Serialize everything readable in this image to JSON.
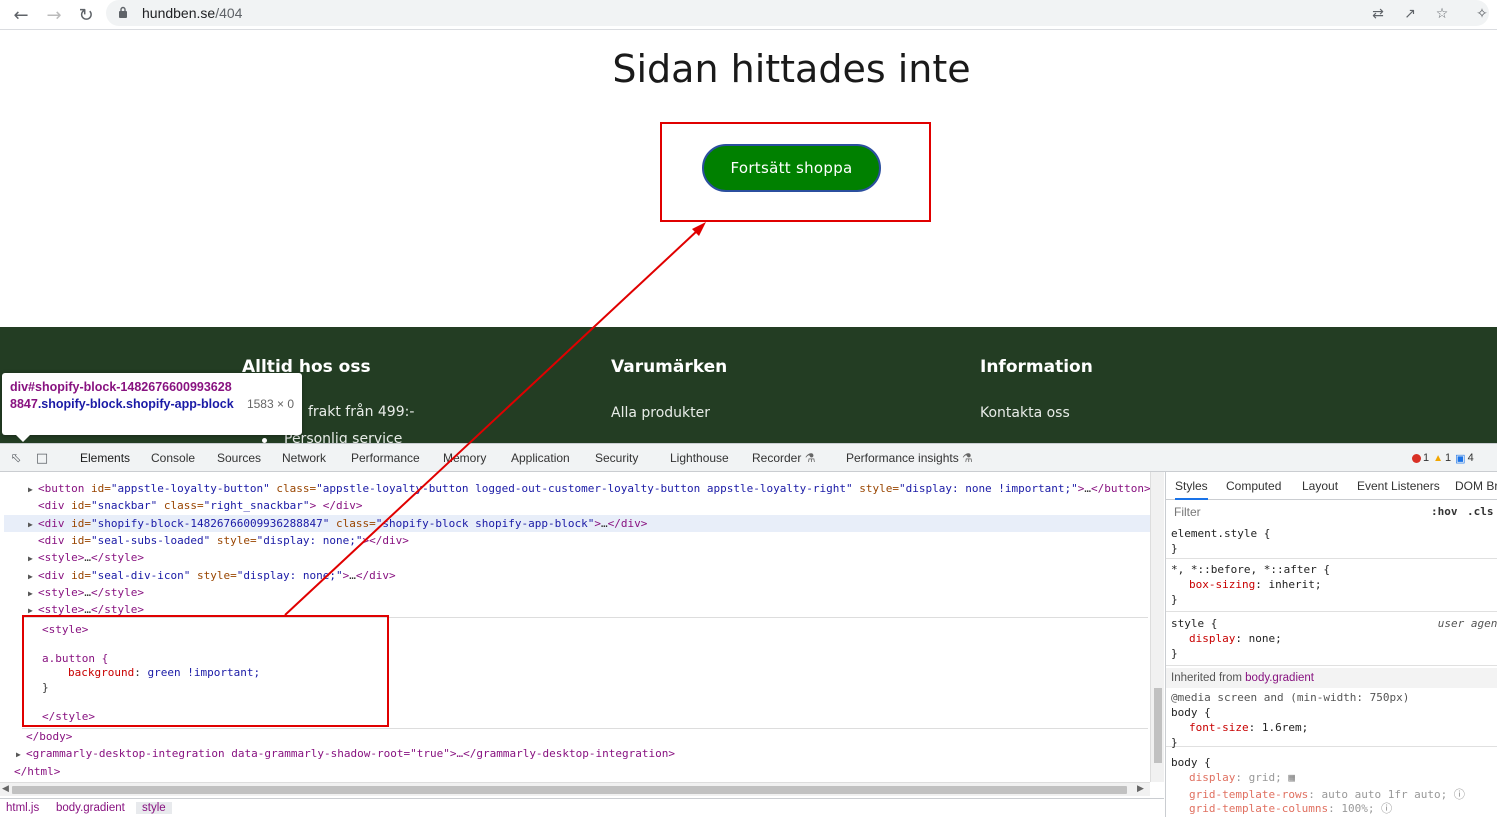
{
  "browser": {
    "url_host": "hundben.se",
    "url_path": "/404"
  },
  "page": {
    "title": "Sidan hittades inte",
    "button_label": "Fortsätt shoppa",
    "button_color": "#008000",
    "footer_bg": "#233d23",
    "footer": {
      "col1_head": "Alltid hos oss",
      "col1_item1": "frakt från 499:-",
      "col1_item2": "Personlig service",
      "col2_head": "Varumärken",
      "col2_item1": "Alla produkter",
      "col3_head": "Information",
      "col3_item1": "Kontakta oss"
    }
  },
  "tooltip": {
    "selector_tag": "div#shopify-block-14826766009936288847",
    "selector_class": ".shopify-block.shopify-app-block",
    "size": "1583 × 0"
  },
  "devtools": {
    "tabs": [
      "Elements",
      "Console",
      "Sources",
      "Network",
      "Performance",
      "Memory",
      "Application",
      "Security",
      "Lighthouse",
      "Recorder",
      "Performance insights"
    ],
    "errors": "1",
    "warnings": "1",
    "messages": "4",
    "dom_lines": [
      {
        "indent": 1,
        "tri": "▶",
        "parts": [
          [
            "tg",
            "<button "
          ],
          [
            "an",
            "id="
          ],
          [
            "av",
            "\"appstle-loyalty-button\""
          ],
          [
            "an",
            " class="
          ],
          [
            "av",
            "\"appstle-loyalty-button logged-out-customer-loyalty-button appstle-loyalty-right\""
          ],
          [
            "an",
            " style="
          ],
          [
            "av",
            "\"display: none !important;\""
          ],
          [
            "tg",
            ">"
          ],
          [
            "pl",
            "…"
          ],
          [
            "tg",
            "</button>"
          ]
        ]
      },
      {
        "indent": 1,
        "tri": "",
        "parts": [
          [
            "tg",
            "<div "
          ],
          [
            "an",
            "id="
          ],
          [
            "av",
            "\"snackbar\""
          ],
          [
            "an",
            " class="
          ],
          [
            "av",
            "\"right_snackbar\""
          ],
          [
            "tg",
            "> </div>"
          ]
        ]
      },
      {
        "indent": 1,
        "tri": "▶",
        "sel": true,
        "parts": [
          [
            "tg",
            "<div "
          ],
          [
            "an",
            "id="
          ],
          [
            "av",
            "\"shopify-block-14826766009936288847\""
          ],
          [
            "an",
            " class="
          ],
          [
            "av",
            "\"shopify-block shopify-app-block\""
          ],
          [
            "tg",
            ">"
          ],
          [
            "pl",
            "…"
          ],
          [
            "tg",
            "</div>"
          ]
        ]
      },
      {
        "indent": 1,
        "tri": "",
        "parts": [
          [
            "tg",
            "<div "
          ],
          [
            "an",
            "id="
          ],
          [
            "av",
            "\"seal-subs-loaded\""
          ],
          [
            "an",
            " style="
          ],
          [
            "av",
            "\"display: none;\""
          ],
          [
            "tg",
            "></div>"
          ]
        ]
      },
      {
        "indent": 1,
        "tri": "▶",
        "parts": [
          [
            "tg",
            "<style>"
          ],
          [
            "pl",
            "…"
          ],
          [
            "tg",
            "</style>"
          ]
        ]
      },
      {
        "indent": 1,
        "tri": "▶",
        "parts": [
          [
            "tg",
            "<div "
          ],
          [
            "an",
            "id="
          ],
          [
            "av",
            "\"seal-div-icon\""
          ],
          [
            "an",
            " style="
          ],
          [
            "av",
            "\"display: none;\""
          ],
          [
            "tg",
            ">"
          ],
          [
            "pl",
            "…"
          ],
          [
            "tg",
            "</div>"
          ]
        ]
      },
      {
        "indent": 1,
        "tri": "▶",
        "parts": [
          [
            "tg",
            "<style>"
          ],
          [
            "pl",
            "…"
          ],
          [
            "tg",
            "</style>"
          ]
        ]
      },
      {
        "indent": 1,
        "tri": "▶",
        "parts": [
          [
            "tg",
            "<style>"
          ],
          [
            "pl",
            "…"
          ],
          [
            "tg",
            "</style>"
          ]
        ]
      }
    ],
    "style_block": {
      "open": "<style>",
      "selector": "a.button {",
      "prop": "background",
      "value": "green !important;",
      "close_brace": "}",
      "close": "</style>"
    },
    "tail_lines": {
      "body_close": "</body>",
      "grammarly": "<grammarly-desktop-integration data-grammarly-shadow-root=\"true\">…</grammarly-desktop-integration>",
      "html_close": "</html>"
    },
    "breadcrumbs": [
      "html.js",
      "body.gradient",
      "style"
    ],
    "styles_tabs": [
      "Styles",
      "Computed",
      "Layout",
      "Event Listeners",
      "DOM Br"
    ],
    "filter_placeholder": "Filter",
    "hov": ":hov",
    "cls": ".cls",
    "rules": {
      "element_style": "element.style {",
      "universal_sel": "*, *::before, *::after {",
      "universal_prop": "box-sizing",
      "universal_val": "inherit;",
      "style_sel": "style {",
      "style_origin": "user agent",
      "style_prop": "display",
      "style_val": "none;",
      "inherited_label": "Inherited from ",
      "inherited_from": "body.gradient",
      "media": "@media screen and (min-width: 750px)",
      "body_sel": "body {",
      "body_prop": "font-size",
      "body_val": "1.6rem;",
      "body2_sel": "body {",
      "body2_p1": "display",
      "body2_v1": "grid;",
      "body2_p2": "grid-template-rows",
      "body2_v2": "auto auto 1fr auto;",
      "body2_p3": "grid-template-columns",
      "body2_v3": "100%;",
      "close": "}"
    }
  }
}
